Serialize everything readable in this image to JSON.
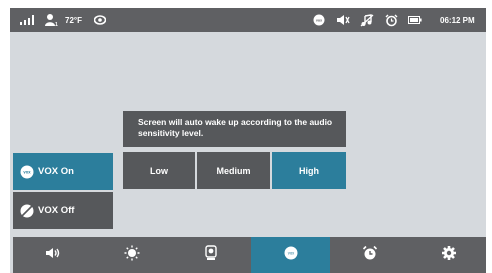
{
  "status_bar": {
    "temperature": "72°F",
    "time": "06:12 PM"
  },
  "popup": {
    "message": "Screen will auto wake up according to the audio sensitivity level.",
    "sensitivity_options": [
      {
        "label": "Low",
        "selected": false
      },
      {
        "label": "Medium",
        "selected": false
      },
      {
        "label": "High",
        "selected": true
      }
    ]
  },
  "vox": {
    "on_label": "VOX On",
    "off_label": "VOX Off",
    "on_icon_text": "vox",
    "selected": "on"
  },
  "bottom_bar": {
    "items": [
      {
        "icon": "speaker-volume-icon",
        "selected": false
      },
      {
        "icon": "brightness-icon",
        "selected": false
      },
      {
        "icon": "camera-icon",
        "selected": false
      },
      {
        "icon": "vox-icon",
        "selected": true
      },
      {
        "icon": "alarm-clock-icon",
        "selected": false
      },
      {
        "icon": "settings-gear-icon",
        "selected": false
      }
    ]
  },
  "colors": {
    "bar": "#5f6063",
    "panel": "#56585b",
    "accent": "#2c7e9c",
    "screen_bg": "#d5d9dd"
  }
}
